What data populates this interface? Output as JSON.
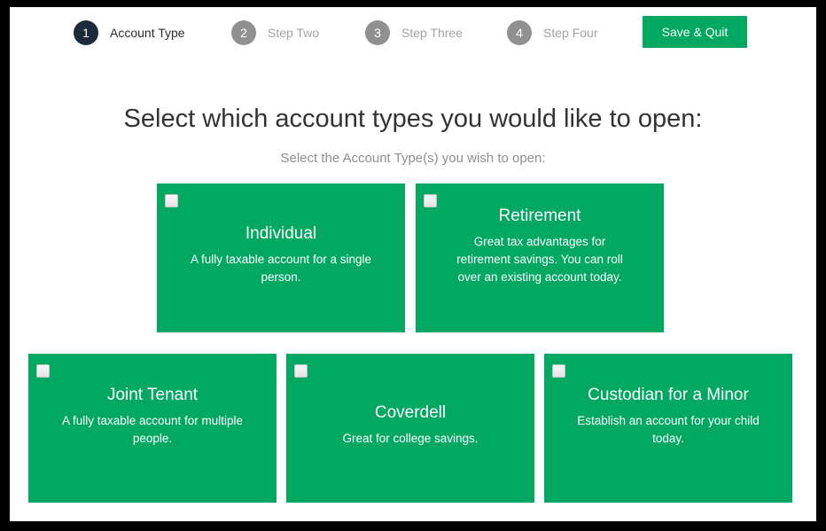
{
  "stepper": {
    "steps": [
      {
        "number": "1",
        "label": "Account Type",
        "state": "active"
      },
      {
        "number": "2",
        "label": "Step Two",
        "state": "inactive"
      },
      {
        "number": "3",
        "label": "Step Three",
        "state": "inactive"
      },
      {
        "number": "4",
        "label": "Step Four",
        "state": "inactive"
      }
    ],
    "save_label": "Save & Quit"
  },
  "main": {
    "heading": "Select which account types you would like to open:",
    "subheading": "Select the Account Type(s) you wish to open:"
  },
  "cards": [
    {
      "title": "Individual",
      "description": "A fully taxable account for a single person.",
      "checked": false
    },
    {
      "title": "Retirement",
      "description": "Great tax advantages for retirement savings. You can roll over an existing account today.",
      "checked": false
    },
    {
      "title": "Joint Tenant",
      "description": "A fully taxable account for multiple people.",
      "checked": false
    },
    {
      "title": "Coverdell",
      "description": "Great for college savings.",
      "checked": false
    },
    {
      "title": "Custodian for a Minor",
      "description": "Establish an account for your child today.",
      "checked": false
    }
  ],
  "colors": {
    "accent": "#00a862",
    "active_step": "#1d2a3a",
    "inactive_step": "#909090",
    "heading_text": "#333333",
    "muted_text": "#8f8f8f"
  }
}
